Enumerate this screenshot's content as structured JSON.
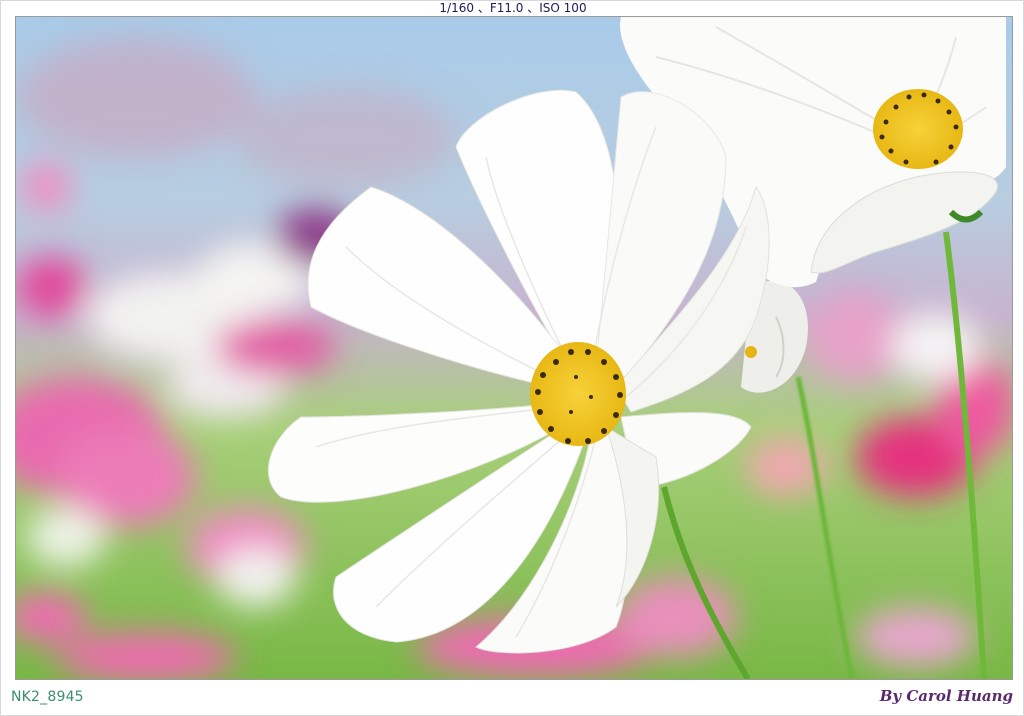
{
  "exif_line": "1/160 、F11.0 、ISO 100",
  "file_id": "NK2_8945",
  "signature": "By Carol Huang",
  "photo": {
    "subject": "white cosmos flowers",
    "colors": {
      "sky": "#9cc3e6",
      "grass": "#7fc24a",
      "blossom_pink": "#e0559f",
      "petal": "#ffffff",
      "center": "#f1c21b"
    }
  }
}
